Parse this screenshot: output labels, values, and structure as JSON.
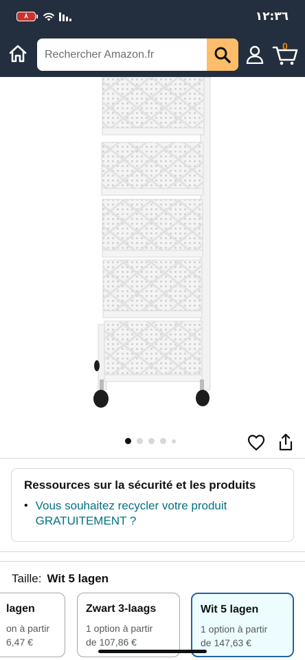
{
  "status_bar": {
    "battery": "٨",
    "time": "١٢:٣٦"
  },
  "header": {
    "search_placeholder": "Rechercher Amazon.fr",
    "cart_count": "0"
  },
  "carousel": {
    "dots": 5,
    "active_index": 0
  },
  "safety": {
    "title": "Ressources sur la sécurité et les produits",
    "link": "Vous souhaitez recycler votre produit GRATUITEMENT ?"
  },
  "size": {
    "label": "Taille:",
    "selected": "Wit 5 lagen",
    "options": [
      {
        "name": "lagen",
        "line1": "on à partir",
        "line2": "6,47 €"
      },
      {
        "name": "Zwart 3-laags",
        "line1": "1 option à partir",
        "line2": "de 107,86 €"
      },
      {
        "name": "Wit 5 lagen",
        "line1": "1 option à partir",
        "line2": "de 147,63 €"
      }
    ]
  },
  "colors": {
    "header_bg": "#232f3e",
    "search_button": "#febd69",
    "link": "#007185",
    "selected_border": "#2162a1"
  }
}
